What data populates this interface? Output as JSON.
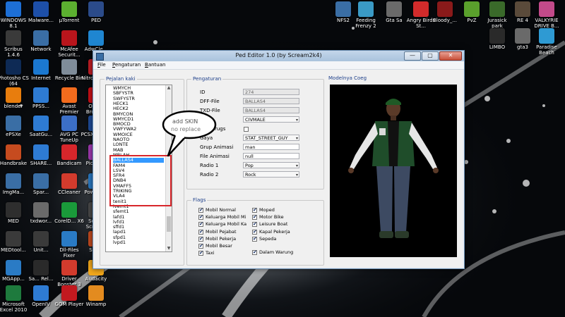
{
  "window": {
    "title": "Ped Editor 1.0 (by Scream2k4)",
    "menu": [
      {
        "underline": "F",
        "rest": "ile"
      },
      {
        "underline": "P",
        "rest": "engaturan"
      },
      {
        "underline": "B",
        "rest": "antuan"
      }
    ],
    "window_buttons": {
      "minimize": "—",
      "maximize": "▢",
      "close": "✕"
    }
  },
  "left_panel": {
    "title": "Pejalan kaki",
    "list": [
      "WMYCH",
      "SBFYSTR",
      "SWFYSTR",
      "HECK1",
      "HECK2",
      "BMYCON",
      "WMYCD1",
      "BMOCD",
      "VWFYWA2",
      "WMOICE",
      "NAOTO",
      "LONTE",
      "MAB",
      "MBLAH",
      "BALLAS4",
      "FAM4",
      "LSV4",
      "SFR4",
      "DNB4",
      "VMAFF5",
      "TRIKING",
      "VLA4",
      "tenit1",
      "lvemt1",
      "sfemt1",
      "lafd1",
      "lvfd1",
      "sffd1",
      "lapd1",
      "sfpd1",
      "lvpd1"
    ],
    "selected": "BALLAS4",
    "scroll_up": "▲",
    "scroll_down": "▼"
  },
  "settings": {
    "title": "Pengaturan",
    "rows": [
      {
        "label": "ID",
        "value": "274",
        "kind": "readonly"
      },
      {
        "label": "DFF-File",
        "value": "BALLAS4",
        "kind": "readonly"
      },
      {
        "label": "TXD-File",
        "value": "BALLAS4",
        "kind": "readonly"
      },
      {
        "label": "Type",
        "value": "CIVMALE",
        "kind": "combo"
      },
      {
        "label": "Buy Drugs",
        "value": "",
        "kind": "checkbox"
      },
      {
        "label": "Gaya",
        "value": "STAT_STREET_GUY",
        "kind": "combo"
      },
      {
        "label": "Grup Animasi",
        "value": "man",
        "kind": "text"
      },
      {
        "label": "File Animasi",
        "value": "null",
        "kind": "text"
      },
      {
        "label": "Radio 1",
        "value": "Pop",
        "kind": "combo"
      },
      {
        "label": "Radio 2",
        "value": "Rock",
        "kind": "combo"
      }
    ]
  },
  "flags": {
    "title": "Flags",
    "left": [
      "Mobil Normal",
      "Keluarga Mobil Mi",
      "Keluarga Mobil Ka",
      "Mobil Pejabat",
      "Mobil Pekerja",
      "Mobil Besar",
      "Taxi"
    ],
    "right": [
      "Moped",
      "Motor Bike",
      "Leisure Boat",
      "Kapal Pekerja",
      "Sepeda",
      "Dalam Warung"
    ]
  },
  "model_view": {
    "title": "Modelnya Coeg"
  },
  "annotation": {
    "bubble_text": "add SKIN",
    "bubble_text2": "no replace"
  },
  "desktop": {
    "left_icons": [
      {
        "label": "WINDOWS 8.1",
        "icon": "windows-icon",
        "color": "#1d6fd6"
      },
      {
        "label": "Malware...",
        "icon": "shield-icon",
        "color": "#1d4fa8"
      },
      {
        "label": "µTorrent",
        "icon": "utorrent-icon",
        "color": "#5cb030"
      },
      {
        "label": "PED",
        "icon": "folder-icon",
        "color": "#2b4b8a"
      },
      {
        "label": "Scribus 1.4.6",
        "icon": "scribus-icon",
        "color": "#3a3a3a"
      },
      {
        "label": "Network",
        "icon": "network-icon",
        "color": "#3a6ea5"
      },
      {
        "label": "McAfee Securit...",
        "icon": "mcafee-icon",
        "color": "#b9151c"
      },
      {
        "label": "AdwCle...",
        "icon": "adwcleaner-icon",
        "color": "#1f86d1"
      },
      {
        "label": "Photosho CS (64",
        "icon": "photoshop-icon",
        "color": "#0e2a55"
      },
      {
        "label": "Internet",
        "icon": "ie-icon",
        "color": "#1b78d0"
      },
      {
        "label": "Recycle Bin",
        "icon": "recycle-bin-icon",
        "color": "#7f8c99"
      },
      {
        "label": "Nitro Pro 10",
        "icon": "nitro-icon",
        "color": "#c21d25"
      },
      {
        "label": "blender",
        "icon": "blender-icon",
        "color": "#e87d0d"
      },
      {
        "label": "PPSS...",
        "icon": "ppsspp-icon",
        "color": "#2e7bd3"
      },
      {
        "label": "Avast Premier",
        "icon": "avast-icon",
        "color": "#f26b1d"
      },
      {
        "label": "Opera Browser",
        "icon": "opera-icon",
        "color": "#cc0f16"
      },
      {
        "label": "ePSXe",
        "icon": "epsxe-icon",
        "color": "#3a6ea5"
      },
      {
        "label": "SaatGu...",
        "icon": "app-icon",
        "color": "#2e7bd3"
      },
      {
        "label": "AVG PC TuneUp",
        "icon": "avg-icon",
        "color": "#3c6fc7"
      },
      {
        "label": "PCSX2 0.9.8 ...",
        "icon": "pcsx2-icon",
        "color": "#1e4c9a"
      },
      {
        "label": "Handbrake",
        "icon": "handbrake-icon",
        "color": "#c64b1f"
      },
      {
        "label": "SHARE...",
        "icon": "share-icon",
        "color": "#2e7bd3"
      },
      {
        "label": "Bandicam",
        "icon": "bandicam-icon",
        "color": "#d7262b"
      },
      {
        "label": "Picasa 3",
        "icon": "picasa-icon",
        "color": "#a33ab4"
      },
      {
        "label": "ImgMa...",
        "icon": "image-icon",
        "color": "#3a6ea5"
      },
      {
        "label": "Spar...",
        "icon": "app-icon",
        "color": "#3a6ea5"
      },
      {
        "label": "CCleaner",
        "icon": "ccleaner-icon",
        "color": "#d23b2d"
      },
      {
        "label": "PowerISO",
        "icon": "poweriso-icon",
        "color": "#2a7bc5"
      },
      {
        "label": "MED",
        "icon": "folder-icon",
        "color": "#2e2e2e"
      },
      {
        "label": "txdwor...",
        "icon": "txd-icon",
        "color": "#6a6a6a"
      },
      {
        "label": "CorelD... X6",
        "icon": "corel-icon",
        "color": "#1a9a3a"
      },
      {
        "label": "Sonny Scribe 3",
        "icon": "app-icon",
        "color": "#4a4a4a"
      },
      {
        "label": "MEDtool...",
        "icon": "app-icon",
        "color": "#3a3a3a"
      },
      {
        "label": "Unit...",
        "icon": "app-icon",
        "color": "#3a3a3a"
      },
      {
        "label": "Dll-Files Fixer",
        "icon": "dll-icon",
        "color": "#2a7bc5"
      },
      {
        "label": "SAMP",
        "icon": "samp-icon",
        "color": "#c44b1f"
      },
      {
        "label": "MGApp...",
        "icon": "app-icon",
        "color": "#2a7bc5"
      },
      {
        "label": "Sa... Rel...",
        "icon": "app-icon",
        "color": "#2a2a2a"
      },
      {
        "label": "Driver Booster 3",
        "icon": "driver-booster-icon",
        "color": "#d23b2d"
      },
      {
        "label": "Audacity",
        "icon": "audacity-icon",
        "color": "#f3a81b"
      },
      {
        "label": "Microsoft Excel 2010",
        "icon": "excel-icon",
        "color": "#1e7a3d"
      },
      {
        "label": "OpenIV",
        "icon": "openiv-icon",
        "color": "#2e7bd3"
      },
      {
        "label": "GOM Player",
        "icon": "gom-icon",
        "color": "#c2191f"
      },
      {
        "label": "Winamp",
        "icon": "winamp-icon",
        "color": "#e38b1f"
      },
      {
        "label": "Microsoft Word 2010",
        "icon": "word-icon",
        "color": "#2b5797"
      },
      {
        "label": "AVG Driver Updater",
        "icon": "avg-icon",
        "color": "#3c6fc7"
      }
    ],
    "right_icons": [
      {
        "label": "NFS2",
        "icon": "nfs-icon",
        "color": "#3a6ea5"
      },
      {
        "label": "Feeding Frenzy 2",
        "icon": "game-icon",
        "color": "#3a9ac5"
      },
      {
        "label": "Gta Sa",
        "icon": "gta-icon",
        "color": "#6a6a6a"
      },
      {
        "label": "Angry Birds St...",
        "icon": "angry-birds-icon",
        "color": "#d22b2b"
      },
      {
        "label": "Bloody_...",
        "icon": "game-icon",
        "color": "#8a1a1a"
      },
      {
        "label": "PvZ",
        "icon": "pvz-icon",
        "color": "#5aa02c"
      },
      {
        "label": "Jurasick park",
        "icon": "game-icon",
        "color": "#3a6a2a"
      },
      {
        "label": "RE 4",
        "icon": "re4-icon",
        "color": "#5a4a3a"
      },
      {
        "label": "VALKYRIE DRIVE B...",
        "icon": "game-icon",
        "color": "#c24a8a"
      },
      {
        "label": "LIMBO",
        "icon": "limbo-icon",
        "color": "#2a2a2a"
      },
      {
        "label": "gta3",
        "icon": "gta3-icon",
        "color": "#6a6a6a"
      },
      {
        "label": "Paradise Beach",
        "icon": "game-icon",
        "color": "#2e9ad3"
      }
    ]
  }
}
